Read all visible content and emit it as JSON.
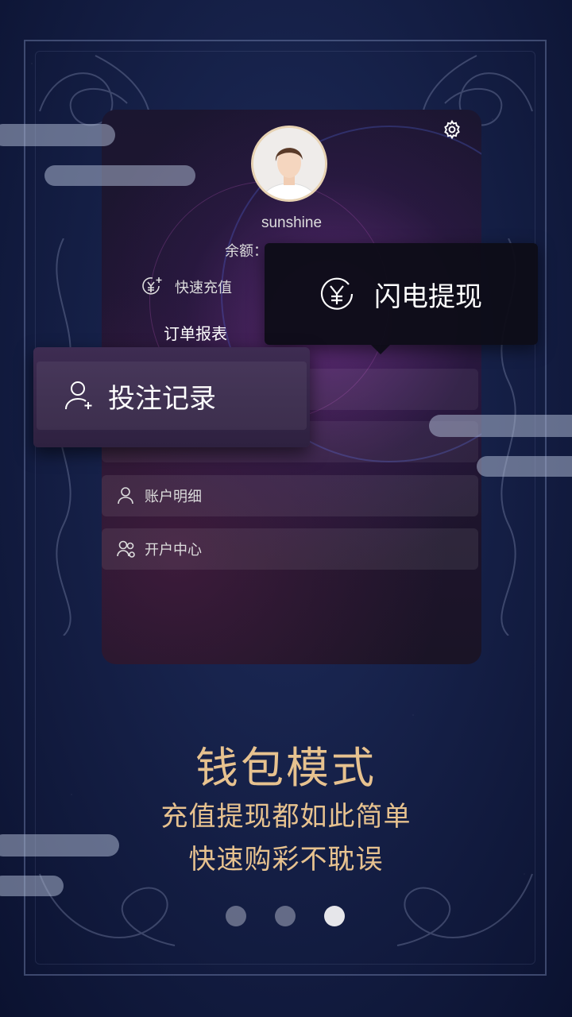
{
  "phone": {
    "username": "sunshine",
    "balance_label": "余额：",
    "quick_recharge": "快速充值",
    "order_report": "订单报表",
    "menu": [
      {
        "label": "账户明细",
        "icon": "user-icon"
      },
      {
        "label": "开户中心",
        "icon": "users-icon"
      }
    ],
    "settings_icon": "gear-icon"
  },
  "popups": {
    "withdraw_label": "闪电提现",
    "withdraw_icon": "yen-circle-icon",
    "bet_label": "投注记录",
    "bet_icon": "user-add-icon"
  },
  "promo": {
    "headline": "钱包模式",
    "line1": "充值提现都如此简单",
    "line2": "快速购彩不耽误"
  },
  "pager": {
    "count": 3,
    "active_index": 2
  },
  "colors": {
    "accent_gold": "#e7c28f",
    "background": "#141e44"
  }
}
